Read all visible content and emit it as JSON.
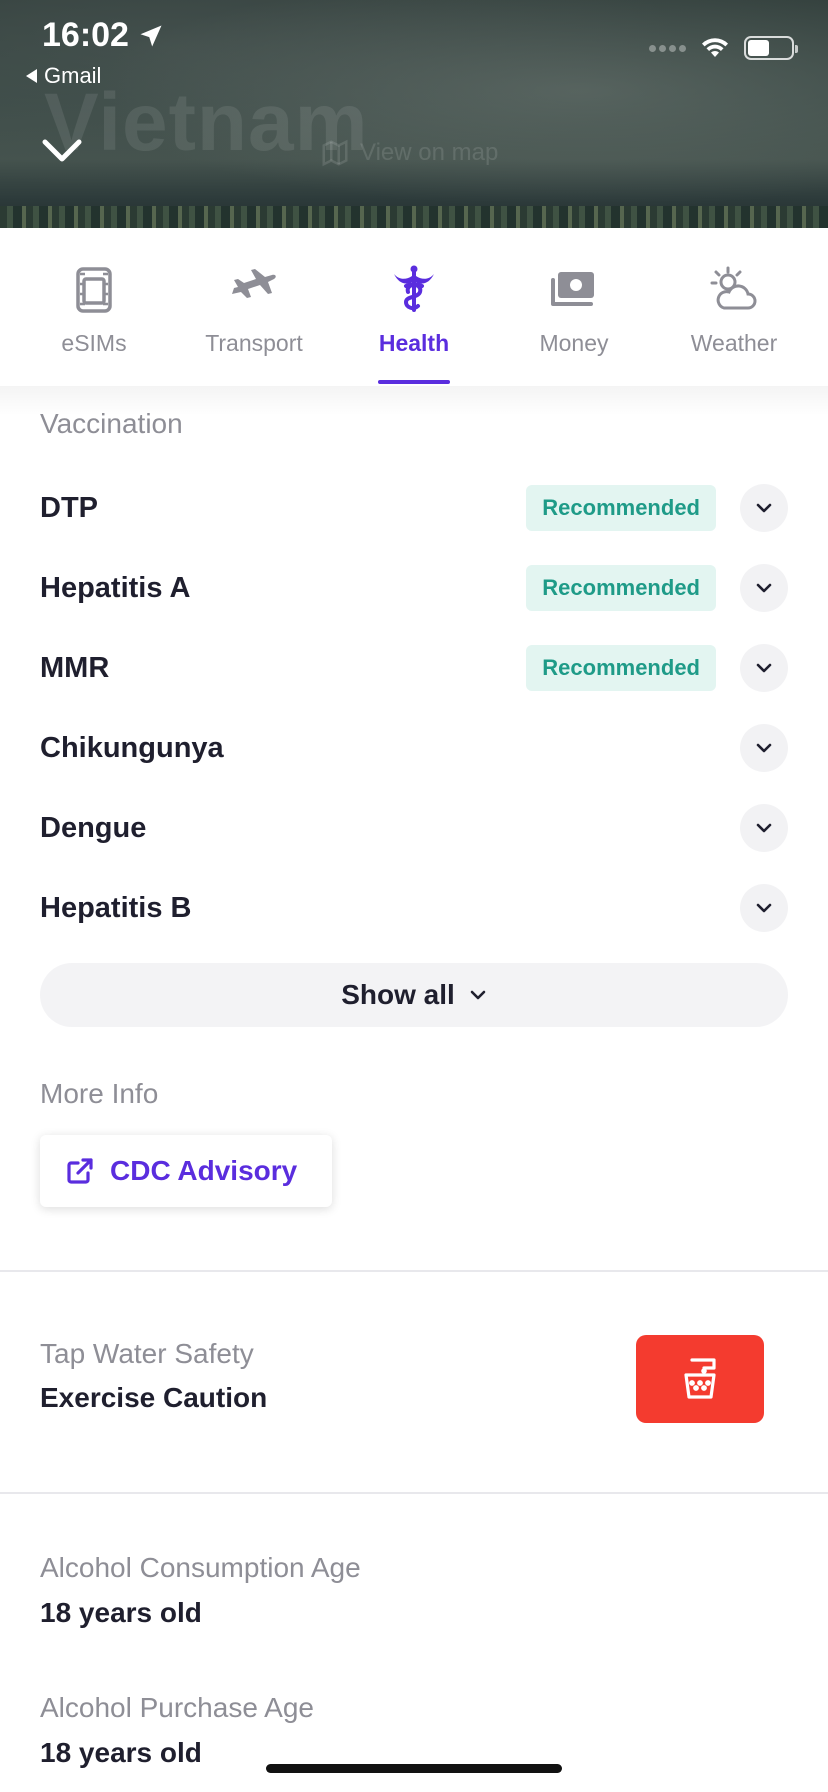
{
  "status_bar": {
    "time": "16:02",
    "back_app": "Gmail",
    "battery_level": 0.5
  },
  "hero": {
    "title": "Vietnam",
    "map_link": "View on map"
  },
  "tabs": [
    {
      "label": "eSIMs",
      "icon": "sim-card-icon",
      "active": false
    },
    {
      "label": "Transport",
      "icon": "airplane-icon",
      "active": false
    },
    {
      "label": "Health",
      "icon": "caduceus-icon",
      "active": true
    },
    {
      "label": "Money",
      "icon": "money-icon",
      "active": false
    },
    {
      "label": "Weather",
      "icon": "partly-cloudy-icon",
      "active": false
    }
  ],
  "vaccination": {
    "heading": "Vaccination",
    "items": [
      {
        "name": "DTP",
        "badge": "Recommended"
      },
      {
        "name": "Hepatitis A",
        "badge": "Recommended"
      },
      {
        "name": "MMR",
        "badge": "Recommended"
      },
      {
        "name": "Chikungunya",
        "badge": ""
      },
      {
        "name": "Dengue",
        "badge": ""
      },
      {
        "name": "Hepatitis B",
        "badge": ""
      }
    ],
    "show_all": "Show all"
  },
  "more_info": {
    "heading": "More Info",
    "link_label": "CDC Advisory"
  },
  "tap_water": {
    "label": "Tap Water Safety",
    "value": "Exercise Caution",
    "icon": "water-glass-icon",
    "color": "#f43b2f"
  },
  "alcohol": {
    "consumption_label": "Alcohol Consumption Age",
    "consumption_value": "18 years old",
    "purchase_label": "Alcohol Purchase Age",
    "purchase_value": "18 years old"
  },
  "colors": {
    "accent": "#5a2dde",
    "recommended_bg": "#e3f5f1",
    "recommended_text": "#1f9b88"
  }
}
